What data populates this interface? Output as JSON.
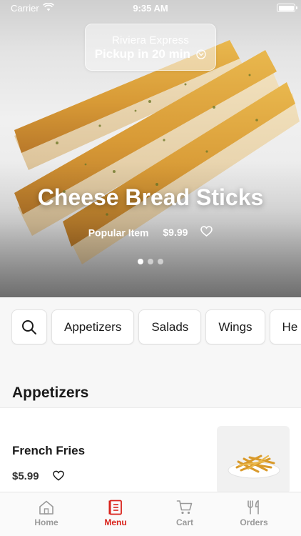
{
  "status_bar": {
    "carrier": "Carrier",
    "time": "9:35 AM"
  },
  "pickup": {
    "store": "Riviera Express",
    "time_label": "Pickup in 20 min"
  },
  "hero": {
    "title": "Cheese Bread Sticks",
    "tag": "Popular Item",
    "price": "$9.99",
    "slide_count": 3,
    "active_slide": 1
  },
  "categories": [
    "Appetizers",
    "Salads",
    "Wings",
    "He"
  ],
  "section": {
    "title": "Appetizers"
  },
  "items": [
    {
      "name": "French Fries",
      "price": "$5.99"
    }
  ],
  "tabbar": {
    "tabs": [
      {
        "label": "Home",
        "icon": "home-icon"
      },
      {
        "label": "Menu",
        "icon": "menu-icon"
      },
      {
        "label": "Cart",
        "icon": "cart-icon"
      },
      {
        "label": "Orders",
        "icon": "utensils-icon"
      }
    ],
    "active": "Menu"
  },
  "colors": {
    "accent": "#d9231b",
    "inactive": "#9a9a9a",
    "background": "#f7f7f7"
  }
}
